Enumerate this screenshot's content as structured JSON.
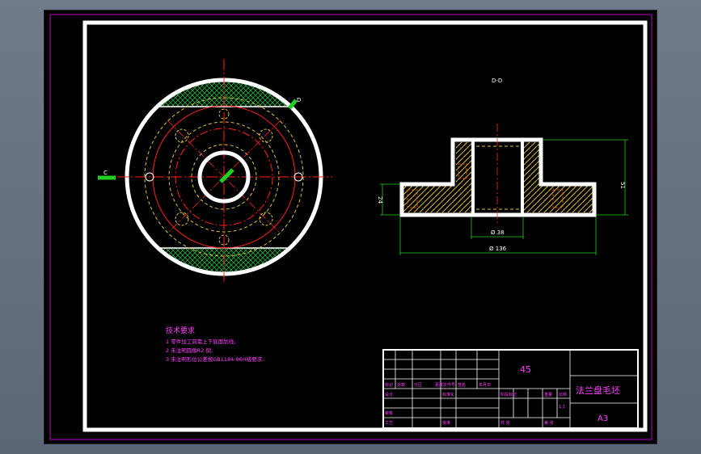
{
  "drawing": {
    "section_label": "D-D",
    "dims": {
      "bore": "Ø 38",
      "outer": "Ø 136",
      "height": "51",
      "flange": "24"
    },
    "view_markers": {
      "left": "C",
      "right": "D"
    },
    "tech_req": {
      "title": "技术要求",
      "lines": [
        "1 零件加工前需上下底面划线;",
        "2 未注明圆角R2 倒;",
        "3 未注明形位公差按GB1184-96H级要求."
      ]
    },
    "title_block": {
      "material": "45",
      "name": "法兰盘毛坯",
      "size": "A3",
      "labels": {
        "mark": "标记",
        "count": "处数",
        "zone": "分区",
        "doc": "更改文件号",
        "sign": "签名",
        "date": "年月日",
        "design": "设计",
        "standard": "标准化",
        "check": "审核",
        "process": "工艺",
        "approve": "批准",
        "stage": "阶段标记",
        "weight": "重量",
        "scale": "比例",
        "sheets": "共 张",
        "sheet_no": "第 张",
        "scale_value": "1:1"
      }
    }
  }
}
